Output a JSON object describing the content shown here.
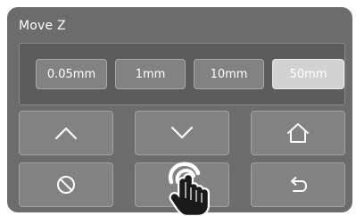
{
  "panel": {
    "title": "Move Z"
  },
  "step_options": [
    {
      "label": "0.05mm",
      "selected": false
    },
    {
      "label": "1mm",
      "selected": false
    },
    {
      "label": "10mm",
      "selected": false
    },
    {
      "label": "50mm",
      "selected": true
    }
  ],
  "controls": [
    {
      "name": "move-up-button",
      "icon": "chevron-up-icon"
    },
    {
      "name": "move-down-button",
      "icon": "chevron-down-icon"
    },
    {
      "name": "home-button",
      "icon": "home-icon"
    },
    {
      "name": "stop-button",
      "icon": "prohibit-icon"
    },
    {
      "name": "center-button",
      "icon": "hand-pointer-icon"
    },
    {
      "name": "back-button",
      "icon": "undo-arrow-icon"
    }
  ],
  "colors": {
    "panel_bg": "#6c6c6c",
    "button_bg": "#828282",
    "selected_bg": "#d2d2d2",
    "text": "#ffffff"
  }
}
